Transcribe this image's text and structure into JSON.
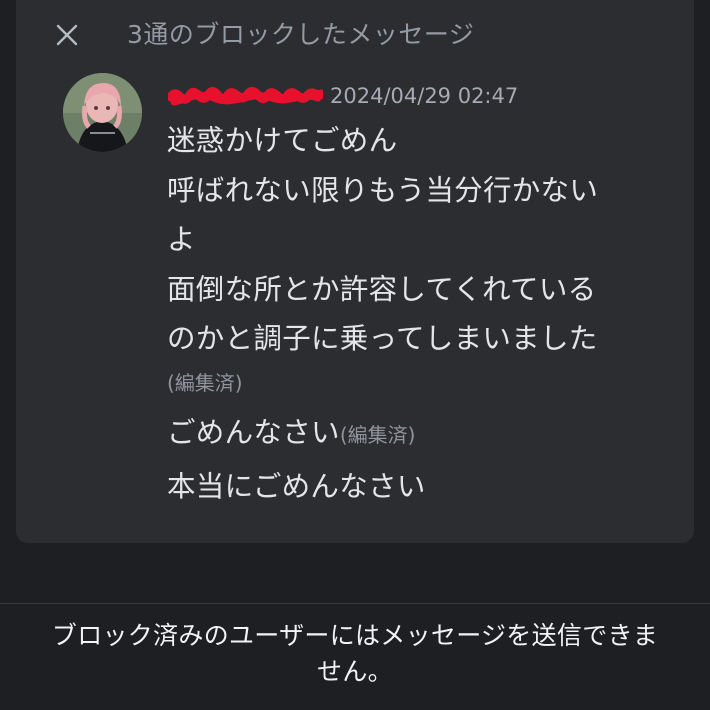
{
  "header": {
    "close_icon": "close-icon",
    "title": "3通のブロックしたメッセージ"
  },
  "message": {
    "author": "redacted-username",
    "timestamp": "2024/04/29 02:47",
    "lines": [
      "迷惑かけてごめん",
      "呼ばれない限りもう当分行かない",
      "よ",
      "面倒な所とか許容してくれている",
      "のかと調子に乗ってしまいました"
    ],
    "edited_label_1": "(編集済)",
    "line2": "ごめんなさい",
    "edited_label_2": "(編集済)",
    "line3": "本当にごめんなさい"
  },
  "footer": {
    "notice_line1": "ブロック済みのユーザーにはメッセージを送信できま",
    "notice_line2": "せん。"
  },
  "colors": {
    "background": "#1e1f22",
    "panel": "#2b2d31",
    "redaction": "#e8112d"
  }
}
